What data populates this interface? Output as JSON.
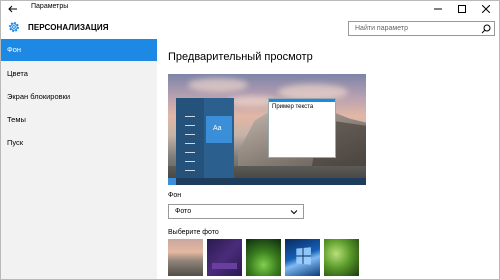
{
  "window": {
    "title": "Параметры"
  },
  "header": {
    "title": "ПЕРСОНАЛИЗАЦИЯ"
  },
  "search": {
    "placeholder": "Найти параметр"
  },
  "sidebar": {
    "items": [
      {
        "label": "Фон",
        "active": true
      },
      {
        "label": "Цвета",
        "active": false
      },
      {
        "label": "Экран блокировки",
        "active": false
      },
      {
        "label": "Темы",
        "active": false
      },
      {
        "label": "Пуск",
        "active": false
      }
    ]
  },
  "main": {
    "preview_title": "Предварительный просмотр",
    "preview": {
      "tile_label": "Aa",
      "sample_text": "Пример текста"
    },
    "background_label": "Фон",
    "background_value": "Фото",
    "choose_photo_label": "Выберите фото"
  },
  "colors": {
    "accent": "#1e88e5",
    "sidebar_bg": "#f2f2f2"
  }
}
